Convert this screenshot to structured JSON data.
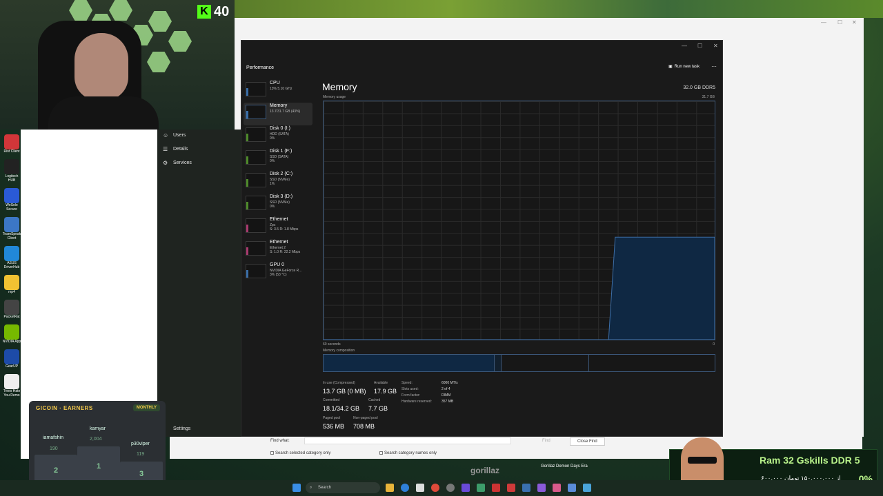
{
  "stream": {
    "kick_viewer_count": "40"
  },
  "desktop_icons": [
    {
      "label": "Riot Client",
      "icon": "riot-icon",
      "color": "#d13639"
    },
    {
      "label": "Logitech HUB",
      "icon": "logitech-icon",
      "color": "#222222"
    },
    {
      "label": "WeSolo Secure",
      "icon": "shield-icon",
      "color": "#2a5ad6"
    },
    {
      "label": "TeamSpeak Client",
      "icon": "teamspeak-icon",
      "color": "#3c77c6"
    },
    {
      "label": "ASUS DriverHub",
      "icon": "asus-icon",
      "color": "#2188d8"
    },
    {
      "label": "mp4",
      "icon": "folder-icon",
      "color": "#f1c232"
    },
    {
      "label": "PacketRat",
      "icon": "packetrat-icon",
      "color": "#444444"
    },
    {
      "label": "NVIDIA App",
      "icon": "nvidia-icon",
      "color": "#76b900"
    },
    {
      "label": "GearUP",
      "icon": "gearup-icon",
      "color": "#1d4ba8"
    },
    {
      "label": "Trees Hate You Demo",
      "icon": "game-icon",
      "color": "#eeeeee"
    }
  ],
  "settings_nav": [
    {
      "label": "Users",
      "icon": "users-icon"
    },
    {
      "label": "Details",
      "icon": "details-icon"
    },
    {
      "label": "Services",
      "icon": "services-icon"
    },
    {
      "label": "Settings",
      "icon": "gear-icon"
    }
  ],
  "task_manager": {
    "title": "Performance",
    "run_new_task": "Run new task",
    "more": "···",
    "sidebar": [
      {
        "name": "CPU",
        "sub1": "13% 5.10 GHz",
        "sub2": "",
        "sub3": ""
      },
      {
        "name": "Memory",
        "sub1": "13.7/31.7 GB (43%)",
        "sub2": "",
        "sub3": ""
      },
      {
        "name": "Disk 0 (I:)",
        "sub1": "HDD (SATA)",
        "sub2": "0%",
        "sub3": ""
      },
      {
        "name": "Disk 1 (F:)",
        "sub1": "SSD (SATA)",
        "sub2": "0%",
        "sub3": ""
      },
      {
        "name": "Disk 2 (C:)",
        "sub1": "SSD (NVMe)",
        "sub2": "1%",
        "sub3": ""
      },
      {
        "name": "Disk 3 (D:)",
        "sub1": "SSD (NVMe)",
        "sub2": "0%",
        "sub3": ""
      },
      {
        "name": "Ethernet",
        "sub1": "Zpc",
        "sub2": "S: 3.5 R: 1.8 Mbps",
        "sub3": ""
      },
      {
        "name": "Ethernet",
        "sub1": "Ethernet 2",
        "sub2": "S: 1.0 R: 22.2 Mbps",
        "sub3": ""
      },
      {
        "name": "GPU 0",
        "sub1": "NVIDIA GeForce R...",
        "sub2": "3% (53 °C)",
        "sub3": ""
      }
    ],
    "heading": "Memory",
    "capacity": "32.0 GB DDR5",
    "usage_label": "Memory usage",
    "usage_max": "31.7 GB",
    "time_left": "60 seconds",
    "time_right": "0",
    "composition_label": "Memory composition",
    "usage_history_fraction": [
      0,
      0,
      0,
      0,
      0,
      0,
      0,
      0,
      0,
      0,
      0,
      0,
      0,
      0,
      0,
      0,
      0,
      0,
      0,
      0,
      0,
      0,
      0,
      0,
      0,
      0,
      0,
      0,
      0,
      0,
      0,
      0,
      0,
      0,
      0,
      0,
      0,
      0,
      0,
      0,
      0,
      0,
      0,
      0,
      0.43,
      0.43,
      0.43,
      0.43,
      0.43,
      0.43,
      0.43,
      0.43,
      0.43,
      0.43,
      0.43,
      0.43,
      0.43,
      0.43,
      0.43,
      0.43
    ],
    "stats": {
      "in_use_label": "In use (Compressed)",
      "in_use_value": "13.7 GB (0 MB)",
      "available_label": "Available",
      "available_value": "17.9 GB",
      "committed_label": "Committed",
      "committed_value": "18.1/34.2 GB",
      "cached_label": "Cached",
      "cached_value": "7.7 GB",
      "paged_label": "Paged pool",
      "paged_value": "536 MB",
      "nonpaged_label": "Non-paged pool",
      "nonpaged_value": "708 MB"
    },
    "details": [
      {
        "k": "Speed:",
        "v": "6000 MT/s"
      },
      {
        "k": "Slots used:",
        "v": "2 of 4"
      },
      {
        "k": "Form factor:",
        "v": "DIMM"
      },
      {
        "k": "Hardware reserved:",
        "v": "357 MB"
      }
    ]
  },
  "find_bar": {
    "find_what": "Find what:",
    "find_button": "Find",
    "close_find": "Close Find",
    "opt1": "Search selected category only",
    "opt2": "Search category names only"
  },
  "gicoin": {
    "title": "GICOIN · EARNERS",
    "period": "MONTHLY",
    "first_name": "kamyar",
    "first_score": "2,004",
    "second_name": "iamafshin",
    "second_score": "190",
    "third_name": "p30viper",
    "third_score": "119",
    "ranks": [
      "1",
      "2",
      "3"
    ]
  },
  "promo": {
    "title": "Ram 32 Gskills DDR 5",
    "price": "۶۰۰,۰۰۰ از ۱۵۰,۰۰۰,۰۰۰ تومان",
    "badge": "0%"
  },
  "media": {
    "logo_text": "gorillaz",
    "track": "Gorillaz Demon Days Era"
  },
  "taskbar": {
    "search_placeholder": "Search"
  },
  "colors": {
    "accent_blue": "#3b5779",
    "fill_blue": "#0f2843",
    "kick_green": "#53fc18"
  }
}
